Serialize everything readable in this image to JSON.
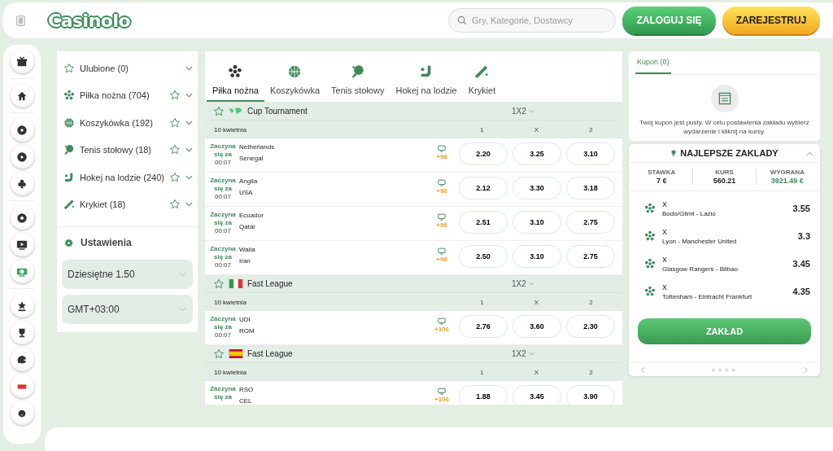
{
  "header": {
    "logo": "Casinolo",
    "search": {
      "placeholder": "Gry, Kategorie, Dostawcy"
    },
    "buttons": [
      {
        "label": "ZALOGUJ SIĘ",
        "kind": "login"
      },
      {
        "label": "ZAREJESTRUJ",
        "kind": "register"
      }
    ]
  },
  "sidebar": {
    "items": [
      {
        "label": "Ulubione (0)",
        "kind": "favorites"
      },
      {
        "label": "Piłka nożna (704)",
        "kind": "football"
      },
      {
        "label": "Koszykówka (192)",
        "kind": "basketball"
      },
      {
        "label": "Tenis stołowy (18)",
        "kind": "pingpong"
      },
      {
        "label": "Hokej na lodzie (240)",
        "kind": "hockey"
      },
      {
        "label": "Krykiet (18)",
        "kind": "cricket"
      }
    ],
    "settings_title": "Ustawienia",
    "selects": [
      {
        "value": "Dziesiętne 1.50"
      },
      {
        "value": "GMT+03:00"
      }
    ]
  },
  "tabs": [
    {
      "label": "Piłka nożna",
      "kind": "football",
      "selected": true
    },
    {
      "label": "Koszykówka",
      "kind": "basketball",
      "selected": false
    },
    {
      "label": "Tenis stołowy",
      "kind": "pingpong",
      "selected": false
    },
    {
      "label": "Hokej na lodzie",
      "kind": "hockey",
      "selected": false
    },
    {
      "label": "Krykiet",
      "kind": "cricket",
      "selected": false
    }
  ],
  "leagues": [
    {
      "name": "Cup Tournament",
      "kind": "world",
      "market": "1X2",
      "date": "10 kwietnia",
      "columns": [
        "1",
        "X",
        "2"
      ],
      "matches": [
        {
          "status": "Zaczyna się za",
          "time": "00:07",
          "home": "Netherlands",
          "away": "Senegal",
          "more": "+98",
          "odds": [
            "2.20",
            "3.25",
            "3.10"
          ]
        },
        {
          "status": "Zaczyna się za",
          "time": "00:07",
          "home": "Anglia",
          "away": "USA",
          "more": "+98",
          "odds": [
            "2.12",
            "3.30",
            "3.18"
          ]
        },
        {
          "status": "Zaczyna się za",
          "time": "00:07",
          "home": "Ecuador",
          "away": "Qatar",
          "more": "+98",
          "odds": [
            "2.51",
            "3.10",
            "2.75"
          ]
        },
        {
          "status": "Zaczyna się za",
          "time": "00:07",
          "home": "Walia",
          "away": "Iran",
          "more": "+98",
          "odds": [
            "2.50",
            "3.10",
            "2.75"
          ]
        }
      ]
    },
    {
      "name": "Fast League",
      "kind": "italy",
      "market": "1X2",
      "date": "10 kwietnia",
      "columns": [
        "1",
        "X",
        "2"
      ],
      "matches": [
        {
          "status": "Zaczyna się za",
          "time": "00:07",
          "home": "UDI",
          "away": "ROM",
          "more": "+106",
          "odds": [
            "2.76",
            "3.60",
            "2.30"
          ]
        }
      ]
    },
    {
      "name": "Fast League",
      "kind": "spain",
      "market": "1X2",
      "date": "10 kwietnia",
      "columns": [
        "1",
        "X",
        "2"
      ],
      "matches": [
        {
          "status": "Zaczyna się za",
          "home": "RSO",
          "away": "CEL",
          "more": "+106",
          "odds": [
            "1.88",
            "3.45",
            "3.90"
          ]
        }
      ]
    }
  ],
  "coupon": {
    "tab": "Kupon (0)",
    "empty_text": "Twój kupon jest pusty. W celu postawienia zakładu wybierz wydarzenie i kliknij na kursy."
  },
  "best_bets": {
    "title": "NAJLEPSZE ZAKLADY",
    "stats": [
      {
        "label": "STAWKA",
        "value": "7 €",
        "highlight": false
      },
      {
        "label": "KURS",
        "value": "560.21",
        "highlight": false
      },
      {
        "label": "WYGRANA",
        "value": "3921.49 €",
        "highlight": true
      }
    ],
    "items": [
      {
        "pick": "X",
        "match": "Bodo/Glimt - Lazio",
        "odds": "3.55"
      },
      {
        "pick": "X",
        "match": "Lyon - Manchester United",
        "odds": "3.3"
      },
      {
        "pick": "X",
        "match": "Glasgow Rangers - Bilbao",
        "odds": "3.45"
      },
      {
        "pick": "X",
        "match": "Tottenham - Eintracht Frankfurt",
        "odds": "4.35"
      }
    ],
    "button": "ZAKŁAD"
  }
}
